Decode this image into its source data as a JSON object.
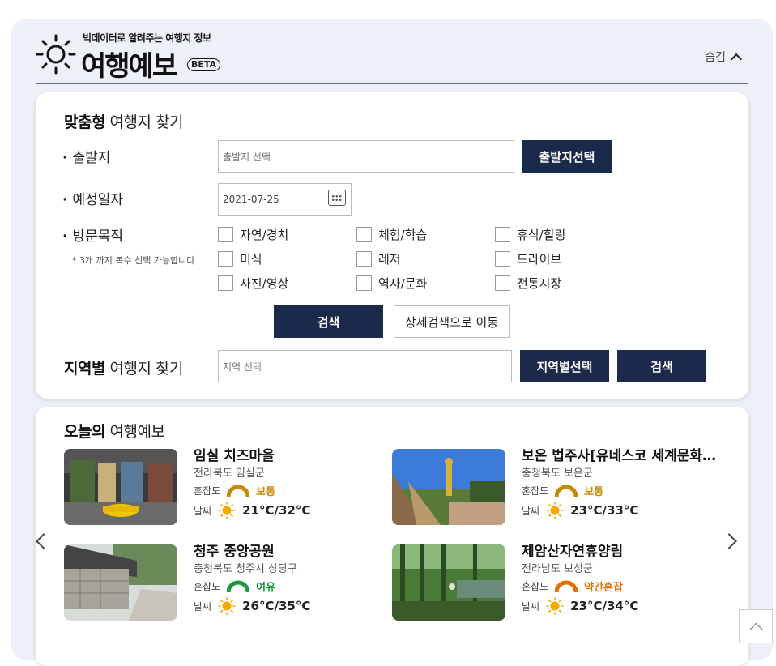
{
  "header": {
    "subtitle": "빅데이터로 알려주는 여행지 정보",
    "title": "여행예보",
    "beta": "BETA",
    "hide_label": "숨김"
  },
  "search": {
    "title_bold": "맞춤형",
    "title_rest": "여행지 찾기",
    "departure_label": "출발지",
    "departure_placeholder": "출발지 선택",
    "departure_button": "출발지선택",
    "date_label": "예정일자",
    "date_value": "2021-07-25",
    "purpose_label": "방문목적",
    "purpose_note": "* 3개 까지 복수 선택 가능합니다",
    "purposes": [
      "자연/경치",
      "체험/학습",
      "휴식/힐링",
      "미식",
      "레저",
      "드라이브",
      "사진/영상",
      "역사/문화",
      "전통시장"
    ],
    "search_button": "검색",
    "detail_button": "상세검색으로 이동"
  },
  "region": {
    "title_bold": "지역별",
    "title_rest": "여행지 찾기",
    "placeholder": "지역 선택",
    "select_button": "지역별선택",
    "search_button": "검색"
  },
  "forecast": {
    "title_bold": "오늘의",
    "title_rest": "여행예보",
    "crowd_label": "혼잡도",
    "weather_label": "날씨",
    "places": [
      {
        "name": "임실 치즈마을",
        "address": "전라북도 임실군",
        "crowd": "보통",
        "temp": "21°C/32°C"
      },
      {
        "name": "보은 법주사[유네스코 세계문화유산]",
        "address": "충청북도 보은군",
        "crowd": "보통",
        "temp": "23°C/33°C"
      },
      {
        "name": "청주 중앙공원",
        "address": "충청북도 청주시 상당구",
        "crowd": "여유",
        "temp": "26°C/35°C"
      },
      {
        "name": "제암산자연휴양림",
        "address": "전라남도 보성군",
        "crowd": "약간혼잡",
        "temp": "23°C/34°C"
      }
    ]
  },
  "colors": {
    "navy": "#1b2a4a",
    "crowd_normal": "#c58a00",
    "crowd_free": "#1a9a3a",
    "crowd_busy": "#e07000",
    "sun": "#f5a800"
  }
}
